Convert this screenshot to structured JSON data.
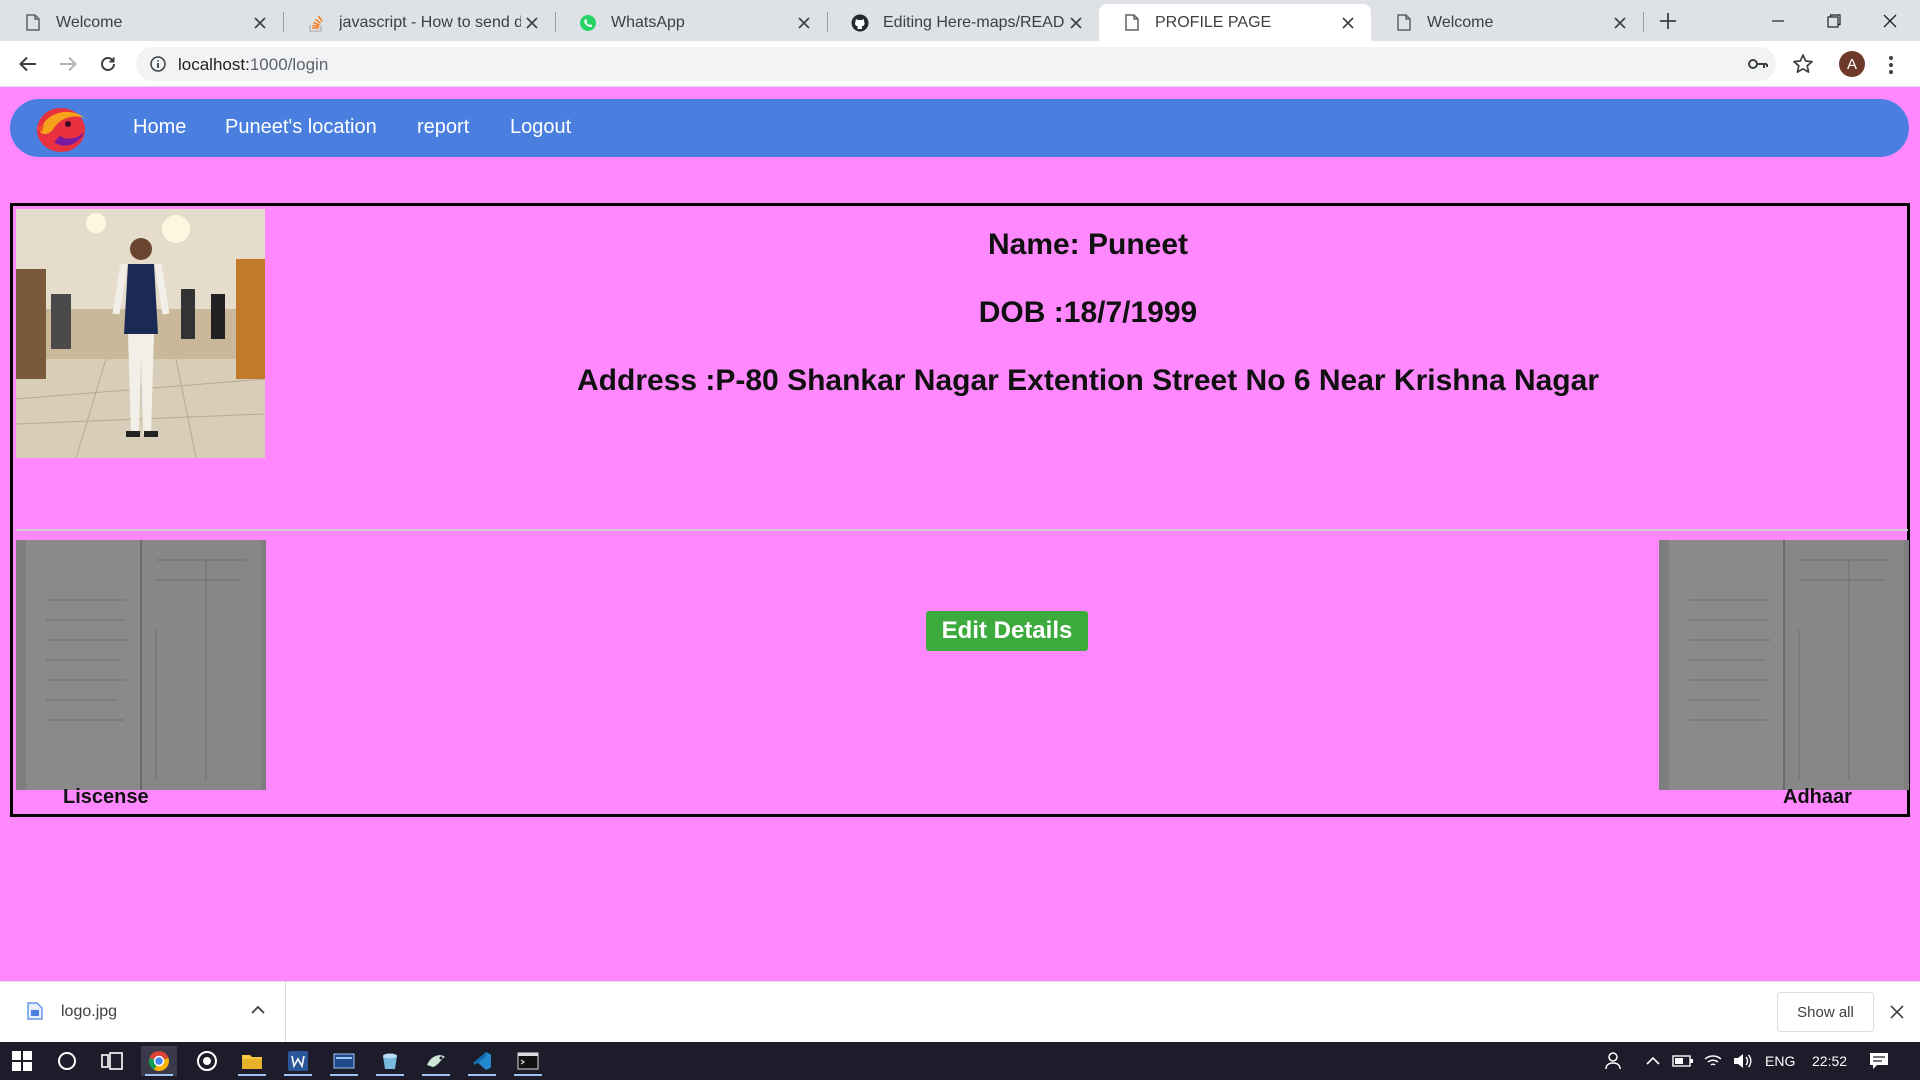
{
  "browser": {
    "tabs": [
      {
        "title": "Welcome",
        "icon": "page-icon"
      },
      {
        "title": "javascript - How to send data",
        "icon": "stackoverflow-icon"
      },
      {
        "title": "WhatsApp",
        "icon": "whatsapp-icon"
      },
      {
        "title": "Editing Here-maps/README",
        "icon": "github-icon"
      },
      {
        "title": "PROFILE PAGE",
        "icon": "page-icon",
        "active": true
      },
      {
        "title": "Welcome",
        "icon": "page-icon"
      }
    ],
    "url": {
      "host": "localhost:",
      "rest": "1000/login"
    },
    "profile_initial": "A"
  },
  "navbar": {
    "links": [
      "Home",
      "Puneet's location",
      "report",
      "Logout"
    ],
    "color": "#4a7fe0"
  },
  "profile": {
    "name_line": "Name: Puneet",
    "dob_line": "DOB :18/7/1999",
    "address_line": "Address :P-80 Shankar Nagar Extention Street No 6 Near Krishna Nagar",
    "edit_button": "Edit Details",
    "license_label": "Liscense",
    "adhaar_label": "Adhaar"
  },
  "page_background": "#ff88ff",
  "downloads": {
    "file_name": "logo.jpg",
    "show_all": "Show all"
  },
  "taskbar": {
    "language": "ENG",
    "time": "22:52"
  }
}
